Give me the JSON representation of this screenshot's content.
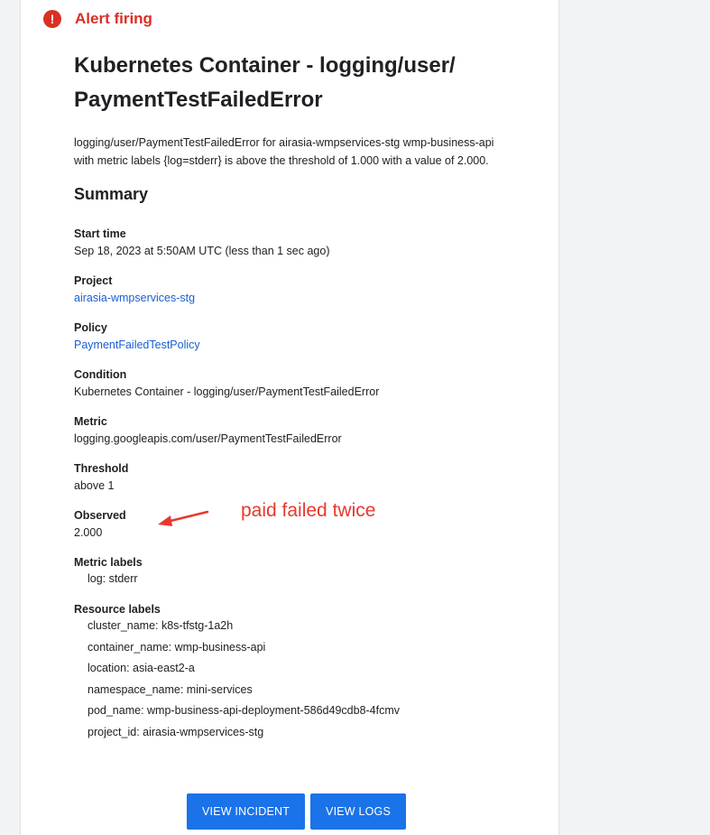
{
  "alert": {
    "status": "Alert firing",
    "icon": "alert-exclamation-icon",
    "color": "#d93025"
  },
  "title": "Kubernetes Container - logging/user/PaymentTestFailedError",
  "title_line1": "Kubernetes Container - logging/user/",
  "title_line2": "PaymentTestFailedError",
  "description_line1": "logging/user/PaymentTestFailedError for airasia-wmpservices-stg wmp-business-api",
  "description_line2": "with metric labels {log=stderr} is above the threshold of 1.000 with a value of 2.000.",
  "summary": {
    "heading": "Summary",
    "start_time": {
      "label": "Start time",
      "value": "Sep 18, 2023 at 5:50AM UTC (less than 1 sec ago)"
    },
    "project": {
      "label": "Project",
      "value": "airasia-wmpservices-stg"
    },
    "policy": {
      "label": "Policy",
      "value": "PaymentFailedTestPolicy"
    },
    "condition": {
      "label": "Condition",
      "value": "Kubernetes Container - logging/user/PaymentTestFailedError"
    },
    "metric": {
      "label": "Metric",
      "value": "logging.googleapis.com/user/PaymentTestFailedError"
    },
    "threshold": {
      "label": "Threshold",
      "value": "above 1"
    },
    "observed": {
      "label": "Observed",
      "value": "2.000"
    },
    "metric_labels": {
      "label": "Metric labels",
      "items": [
        "log: stderr"
      ]
    },
    "resource_labels": {
      "label": "Resource labels",
      "items": [
        "cluster_name: k8s-tfstg-1a2h",
        "container_name: wmp-business-api",
        "location: asia-east2-a",
        "namespace_name: mini-services",
        "pod_name: wmp-business-api-deployment-586d49cdb8-4fcmv",
        "project_id: airasia-wmpservices-stg"
      ]
    }
  },
  "annotation": {
    "text": "paid failed twice",
    "color": "#e8382e"
  },
  "buttons": {
    "view_incident": "VIEW INCIDENT",
    "view_logs": "VIEW LOGS",
    "color": "#1a73e8"
  }
}
